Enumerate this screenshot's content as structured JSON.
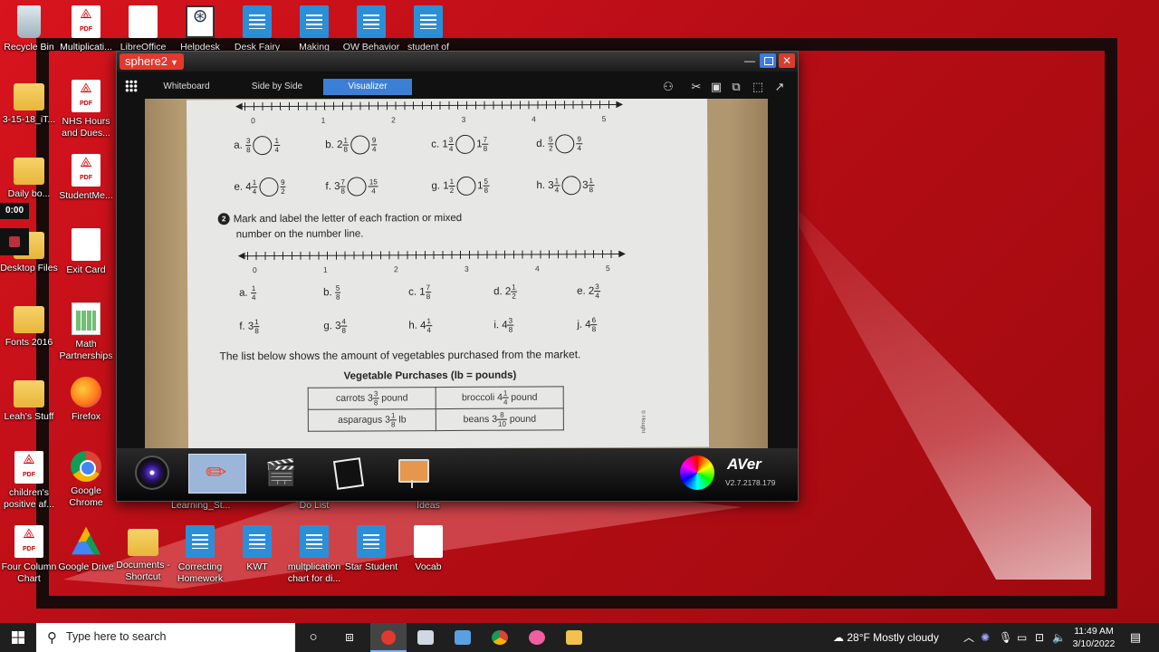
{
  "desktop": {
    "icons": [
      {
        "label": "Recycle Bin",
        "icon": "recycle-bin-icon"
      },
      {
        "label": "Multiplicati...",
        "icon": "pdf-icon"
      },
      {
        "label": "LibreOffice",
        "icon": "document-icon"
      },
      {
        "label": "Helpdesk",
        "icon": "helpdesk-icon"
      },
      {
        "label": "Desk Fairy",
        "icon": "word-doc-icon"
      },
      {
        "label": "Making",
        "icon": "word-doc-icon"
      },
      {
        "label": "OW Behavior",
        "icon": "word-doc-icon"
      },
      {
        "label": "student of",
        "icon": "word-doc-icon"
      },
      {
        "label": "3-15-18_iT...",
        "icon": "folder-icon"
      },
      {
        "label": "NHS Hours and Dues...",
        "icon": "pdf-icon"
      },
      {
        "label": "Daily bo...",
        "icon": "folder-icon"
      },
      {
        "label": "StudentMe...",
        "icon": "pdf-icon"
      },
      {
        "label": "Desktop Files",
        "icon": "folder-icon"
      },
      {
        "label": "Exit Card",
        "icon": "document-icon"
      },
      {
        "label": "Fonts 2016",
        "icon": "folder-icon"
      },
      {
        "label": "Math Partnerships",
        "icon": "spreadsheet-icon"
      },
      {
        "label": "Leah's Stuff",
        "icon": "folder-icon"
      },
      {
        "label": "Firefox",
        "icon": "firefox-icon"
      },
      {
        "label": "children's positive af...",
        "icon": "pdf-icon"
      },
      {
        "label": "Google Chrome",
        "icon": "chrome-icon"
      },
      {
        "label": "Four Column Chart",
        "icon": "pdf-icon"
      },
      {
        "label": "Google Drive",
        "icon": "google-drive-icon"
      },
      {
        "label": "Documents - Shortcut",
        "icon": "folder-icon"
      },
      {
        "label": "Correcting Homework",
        "icon": "word-doc-icon"
      },
      {
        "label": "KWT",
        "icon": "word-doc-icon"
      },
      {
        "label": "multplication chart for di...",
        "icon": "word-doc-icon"
      },
      {
        "label": "Star Student",
        "icon": "word-doc-icon"
      },
      {
        "label": "Vocab",
        "icon": "document-icon"
      },
      {
        "label": "Learning_St...",
        "icon": "document-icon"
      },
      {
        "label": "Do List",
        "icon": "document-icon"
      },
      {
        "label": "Ideas",
        "icon": "document-icon"
      }
    ],
    "recording_timer": "0:00"
  },
  "app": {
    "title": "sphere2",
    "tabs": [
      "Whiteboard",
      "Side by Side",
      "Visualizer"
    ],
    "active_tab": "Visualizer",
    "version": "V2.7.2178.179",
    "brand": "AVer",
    "worksheet": {
      "number_line_labels": [
        "0",
        "1",
        "2",
        "3",
        "4",
        "5"
      ],
      "compare_items": [
        {
          "letter": "a.",
          "left": [
            "",
            "3",
            "8"
          ],
          "right": [
            "",
            "1",
            "4"
          ]
        },
        {
          "letter": "b.",
          "left": [
            "2",
            "1",
            "8"
          ],
          "right": [
            "",
            "9",
            "4"
          ]
        },
        {
          "letter": "c.",
          "left": [
            "1",
            "3",
            "4"
          ],
          "right": [
            "1",
            "7",
            "8"
          ]
        },
        {
          "letter": "d.",
          "left": [
            "",
            "5",
            "2"
          ],
          "right": [
            "",
            "9",
            "4"
          ]
        },
        {
          "letter": "e.",
          "left": [
            "4",
            "1",
            "4"
          ],
          "right": [
            "",
            "9",
            "2"
          ]
        },
        {
          "letter": "f.",
          "left": [
            "3",
            "7",
            "8"
          ],
          "right": [
            "",
            "15",
            "4"
          ]
        },
        {
          "letter": "g.",
          "left": [
            "1",
            "1",
            "2"
          ],
          "right": [
            "1",
            "5",
            "8"
          ]
        },
        {
          "letter": "h.",
          "left": [
            "3",
            "1",
            "4"
          ],
          "right": [
            "3",
            "1",
            "8"
          ]
        }
      ],
      "q2_number": "2",
      "q2_line1": "Mark and label the letter of each fraction or mixed",
      "q2_line2": "number on the number line.",
      "mark_items": [
        {
          "letter": "a.",
          "frac": [
            "",
            "1",
            "4"
          ]
        },
        {
          "letter": "b.",
          "frac": [
            "",
            "5",
            "8"
          ]
        },
        {
          "letter": "c.",
          "frac": [
            "1",
            "7",
            "8"
          ]
        },
        {
          "letter": "d.",
          "frac": [
            "2",
            "1",
            "2"
          ]
        },
        {
          "letter": "e.",
          "frac": [
            "2",
            "3",
            "4"
          ]
        },
        {
          "letter": "f.",
          "frac": [
            "3",
            "1",
            "8"
          ]
        },
        {
          "letter": "g.",
          "frac": [
            "3",
            "4",
            "8"
          ]
        },
        {
          "letter": "h.",
          "frac": [
            "4",
            "1",
            "4"
          ]
        },
        {
          "letter": "i.",
          "frac": [
            "4",
            "3",
            "8"
          ]
        },
        {
          "letter": "j.",
          "frac": [
            "4",
            "6",
            "8"
          ]
        }
      ],
      "list_intro": "The list below shows the amount of vegetables purchased from the market.",
      "table_title": "Vegetable Purchases (lb = pounds)",
      "table": [
        [
          {
            "name": "carrots",
            "frac": [
              "3",
              "3",
              "8"
            ],
            "unit": "pound"
          },
          {
            "name": "broccoli",
            "frac": [
              "4",
              "1",
              "4"
            ],
            "unit": "pound"
          }
        ],
        [
          {
            "name": "asparagus",
            "frac": [
              "3",
              "1",
              "8"
            ],
            "unit": "lb"
          },
          {
            "name": "beans",
            "frac": [
              "3",
              "8",
              "10"
            ],
            "unit": "pound"
          }
        ]
      ],
      "margin_text": "© Hought"
    }
  },
  "taskbar": {
    "search_placeholder": "Type here to search",
    "weather": "28°F  Mostly cloudy",
    "time": "11:49 AM",
    "date": "3/10/2022"
  }
}
